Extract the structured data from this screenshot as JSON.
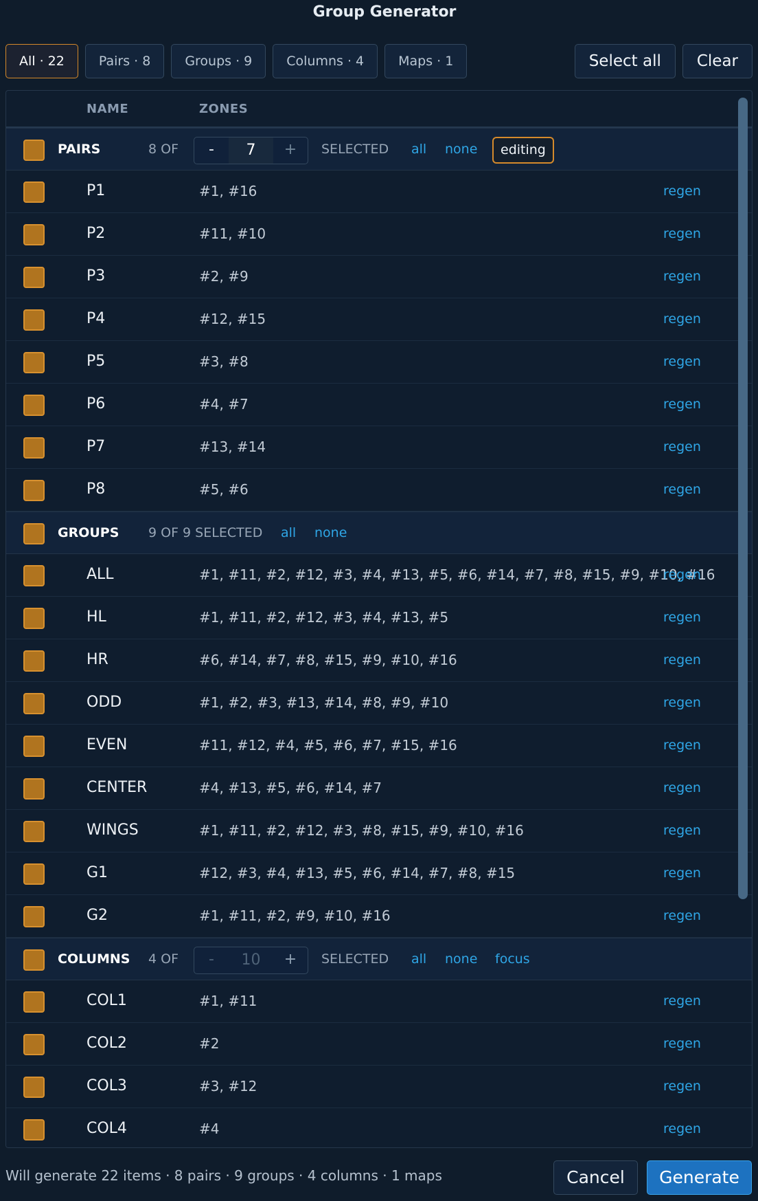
{
  "title": "Group Generator",
  "tabs": [
    {
      "label": "All · 22",
      "active": true
    },
    {
      "label": "Pairs · 8",
      "active": false
    },
    {
      "label": "Groups · 9",
      "active": false
    },
    {
      "label": "Columns · 4",
      "active": false
    },
    {
      "label": "Maps · 1",
      "active": false
    }
  ],
  "actions": {
    "select_all": "Select all",
    "clear": "Clear"
  },
  "table": {
    "col_name": "NAME",
    "col_zones": "ZONES"
  },
  "regen_label": "regen",
  "sections": {
    "pairs": {
      "label": "PAIRS",
      "count": "8 OF",
      "stepper": {
        "minus": "-",
        "value": "7",
        "plus": "+"
      },
      "selected": "SELECTED",
      "all": "all",
      "none": "none",
      "badge": "editing",
      "rows": [
        {
          "name": "P1",
          "zones": "#1, #16"
        },
        {
          "name": "P2",
          "zones": "#11, #10"
        },
        {
          "name": "P3",
          "zones": "#2, #9"
        },
        {
          "name": "P4",
          "zones": "#12, #15"
        },
        {
          "name": "P5",
          "zones": "#3, #8"
        },
        {
          "name": "P6",
          "zones": "#4, #7"
        },
        {
          "name": "P7",
          "zones": "#13, #14"
        },
        {
          "name": "P8",
          "zones": "#5, #6"
        }
      ]
    },
    "groups": {
      "label": "GROUPS",
      "count": "9 OF 9 SELECTED",
      "all": "all",
      "none": "none",
      "rows": [
        {
          "name": "ALL",
          "zones": "#1, #11, #2, #12, #3, #4, #13, #5, #6, #14, #7, #8, #15, #9, #10, #16"
        },
        {
          "name": "HL",
          "zones": "#1, #11, #2, #12, #3, #4, #13, #5"
        },
        {
          "name": "HR",
          "zones": "#6, #14, #7, #8, #15, #9, #10, #16"
        },
        {
          "name": "ODD",
          "zones": "#1, #2, #3, #13, #14, #8, #9, #10"
        },
        {
          "name": "EVEN",
          "zones": "#11, #12, #4, #5, #6, #7, #15, #16"
        },
        {
          "name": "CENTER",
          "zones": "#4, #13, #5, #6, #14, #7"
        },
        {
          "name": "WINGS",
          "zones": "#1, #11, #2, #12, #3, #8, #15, #9, #10, #16"
        },
        {
          "name": "G1",
          "zones": "#12, #3, #4, #13, #5, #6, #14, #7, #8, #15"
        },
        {
          "name": "G2",
          "zones": "#1, #11, #2, #9, #10, #16"
        }
      ]
    },
    "columns": {
      "label": "COLUMNS",
      "count": "4 OF",
      "stepper": {
        "minus": "-",
        "value": "10",
        "plus": "+"
      },
      "selected": "SELECTED",
      "all": "all",
      "none": "none",
      "focus": "focus",
      "rows": [
        {
          "name": "COL1",
          "zones": "#1, #11"
        },
        {
          "name": "COL2",
          "zones": "#2"
        },
        {
          "name": "COL3",
          "zones": "#3, #12"
        },
        {
          "name": "COL4",
          "zones": "#4"
        }
      ]
    }
  },
  "footer": {
    "summary": "Will generate 22 items · 8 pairs · 9 groups · 4 columns · 1 maps",
    "cancel": "Cancel",
    "generate": "Generate"
  },
  "colors": {
    "accent": "#d5892a",
    "checkbox": "#b0741f",
    "link": "#2fa6e6",
    "primary": "#1d72c0",
    "background": "#0f1c2b"
  }
}
